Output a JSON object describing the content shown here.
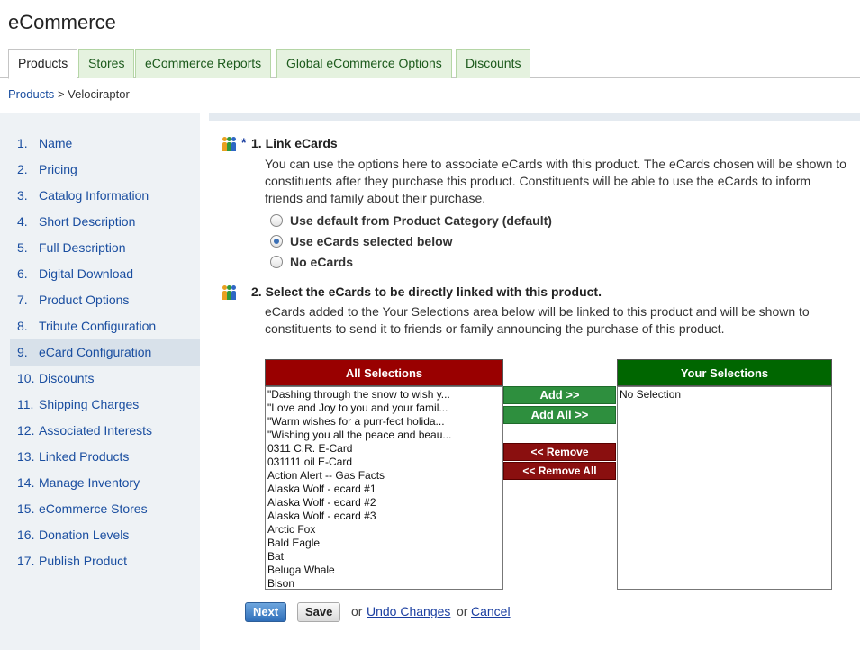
{
  "app": {
    "title": "eCommerce"
  },
  "tabs": [
    "Products",
    "Stores",
    "eCommerce Reports",
    "Global eCommerce Options",
    "Discounts"
  ],
  "breadcrumb": {
    "link": "Products",
    "separator": ">",
    "current": "Velociraptor"
  },
  "sidebar": {
    "items": [
      {
        "num": "1.",
        "label": "Name"
      },
      {
        "num": "2.",
        "label": "Pricing"
      },
      {
        "num": "3.",
        "label": "Catalog Information"
      },
      {
        "num": "4.",
        "label": "Short Description"
      },
      {
        "num": "5.",
        "label": "Full Description"
      },
      {
        "num": "6.",
        "label": "Digital Download"
      },
      {
        "num": "7.",
        "label": "Product Options"
      },
      {
        "num": "8.",
        "label": "Tribute Configuration"
      },
      {
        "num": "9.",
        "label": "eCard Configuration"
      },
      {
        "num": "10.",
        "label": "Discounts"
      },
      {
        "num": "11.",
        "label": "Shipping Charges"
      },
      {
        "num": "12.",
        "label": "Associated Interests"
      },
      {
        "num": "13.",
        "label": "Linked Products"
      },
      {
        "num": "14.",
        "label": "Manage Inventory"
      },
      {
        "num": "15.",
        "label": "eCommerce Stores"
      },
      {
        "num": "16.",
        "label": "Donation Levels"
      },
      {
        "num": "17.",
        "label": "Publish Product"
      }
    ]
  },
  "step1": {
    "required_marker": "*",
    "title": "1. Link eCards",
    "description": "You can use the options here to associate eCards with this product. The eCards chosen will be shown to constituents after they purchase this product. Constituents will be able to use the eCards to inform friends and family about their purchase.",
    "options": [
      "Use default from Product Category (default)",
      "Use eCards selected below",
      "No eCards"
    ]
  },
  "step2": {
    "title": "2. Select the eCards to be directly linked with this product.",
    "description": "eCards added to the Your Selections area below will be linked to this product and will be shown to constituents to send it to friends or family announcing the purchase of this product."
  },
  "selector": {
    "all_header": "All Selections",
    "your_header": "Your Selections",
    "all_items": [
      "\"Dashing through the snow to wish y...",
      "\"Love and Joy to you and your famil...",
      "\"Warm wishes for a purr-fect holida...",
      "\"Wishing you all the peace and beau...",
      "0311 C.R. E-Card",
      "031111 oil E-Card",
      "Action Alert -- Gas Facts",
      "Alaska Wolf - ecard #1",
      "Alaska Wolf - ecard #2",
      "Alaska Wolf - ecard #3",
      "Arctic Fox",
      "Bald Eagle",
      "Bat",
      "Beluga Whale",
      "Bison"
    ],
    "your_items": [
      "No Selection"
    ],
    "add": "Add >>",
    "add_all": "Add All >>",
    "remove": "<< Remove",
    "remove_all": "<< Remove All"
  },
  "footer": {
    "next": "Next",
    "save": "Save",
    "or1": "or",
    "undo": "Undo Changes",
    "or2": "or",
    "cancel": "Cancel"
  },
  "colors": {
    "all_header_bg": "#990000",
    "your_header_bg": "#006600",
    "add_button_bg": "#2e8f3e",
    "remove_button_bg": "#8a0f0f"
  }
}
